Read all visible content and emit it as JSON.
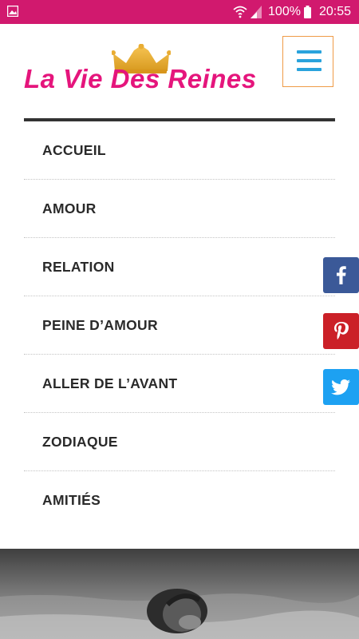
{
  "status_bar": {
    "battery": "100%",
    "time": "20:55",
    "icons": [
      "image-icon",
      "wifi-icon",
      "signal-icon",
      "battery-icon"
    ]
  },
  "site": {
    "logo_text": "La Vie Des Reines",
    "brand_color": "#e5157c",
    "accent_color": "#2aa3dc"
  },
  "nav": {
    "items": [
      {
        "label": "ACCUEIL"
      },
      {
        "label": "AMOUR"
      },
      {
        "label": "RELATION"
      },
      {
        "label": "PEINE D’AMOUR"
      },
      {
        "label": "ALLER DE L’AVANT"
      },
      {
        "label": "ZODIAQUE"
      },
      {
        "label": "AMITIÉS"
      }
    ]
  },
  "share": {
    "buttons": [
      {
        "icon": "facebook-icon",
        "color": "#3b5998"
      },
      {
        "icon": "pinterest-icon",
        "color": "#cb2027"
      },
      {
        "icon": "twitter-icon",
        "color": "#1da1f2"
      }
    ]
  }
}
